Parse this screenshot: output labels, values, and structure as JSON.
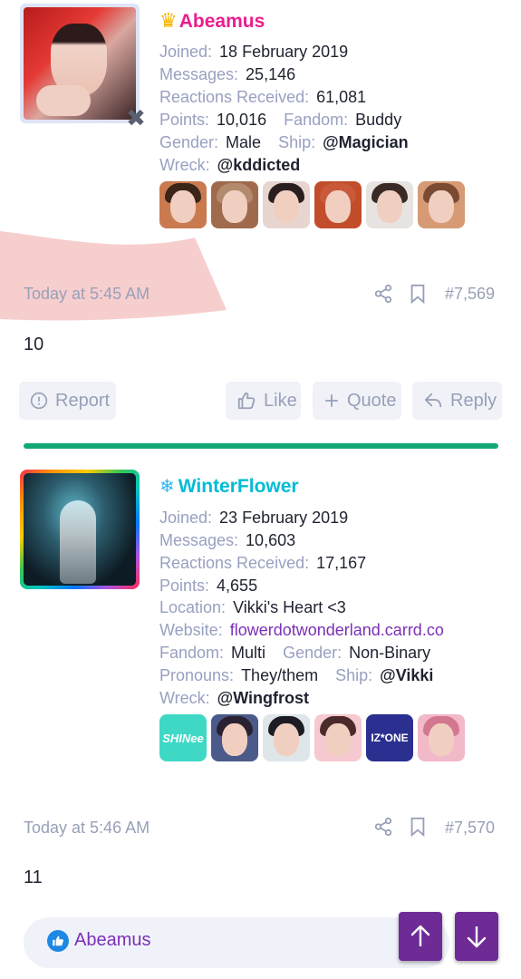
{
  "posts": [
    {
      "username": "Abeamus",
      "fields": [
        {
          "label": "Joined:",
          "value": "18 February 2019"
        },
        {
          "label": "Messages:",
          "value": "25,146"
        },
        {
          "label": "Reactions Received:",
          "value": "61,081"
        }
      ],
      "points_label": "Points:",
      "points_value": "10,016",
      "fandom_label": "Fandom:",
      "fandom_value": "Buddy",
      "gender_label": "Gender:",
      "gender_value": "Male",
      "ship_label": "Ship:",
      "ship_value": "@Magician",
      "wreck_label": "Wreck:",
      "wreck_value": "@kddicted",
      "timestamp": "Today at 5:45 AM",
      "post_number": "#7,569",
      "body": "10"
    },
    {
      "username": "WinterFlower",
      "fields": [
        {
          "label": "Joined:",
          "value": "23 February 2019"
        },
        {
          "label": "Messages:",
          "value": "10,603"
        },
        {
          "label": "Reactions Received:",
          "value": "17,167"
        },
        {
          "label": "Points:",
          "value": "4,655"
        },
        {
          "label": "Location:",
          "value": "Vikki's Heart <3"
        }
      ],
      "website_label": "Website:",
      "website_value": "flowerdotwonderland.carrd.co",
      "fandom_label": "Fandom:",
      "fandom_value": "Multi",
      "gender_label": "Gender:",
      "gender_value": "Non-Binary",
      "pronouns_label": "Pronouns:",
      "pronouns_value": "They/them",
      "ship_label": "Ship:",
      "ship_value": "@Vikki",
      "wreck_label": "Wreck:",
      "wreck_value": "@Wingfrost",
      "chip_texts": [
        "SHINee",
        "IZ*ONE"
      ],
      "timestamp": "Today at 5:46 AM",
      "post_number": "#7,570",
      "body": "11",
      "reacted_by": "Abeamus"
    }
  ],
  "actions": {
    "report": "Report",
    "like": "Like",
    "quote": "Quote",
    "reply": "Reply"
  },
  "icons": {
    "crown": "crown-icon",
    "snowflake": "snowflake-icon",
    "share": "share-icon",
    "bookmark": "bookmark-icon",
    "scroll_up": "arrow-up-icon",
    "scroll_down": "arrow-down-icon"
  },
  "colors": {
    "username_1": "#e91e8c",
    "username_2": "#00bcd4",
    "divider": "#12a976",
    "nav_button": "#6e2b96",
    "website_link": "#7b2fb6"
  }
}
